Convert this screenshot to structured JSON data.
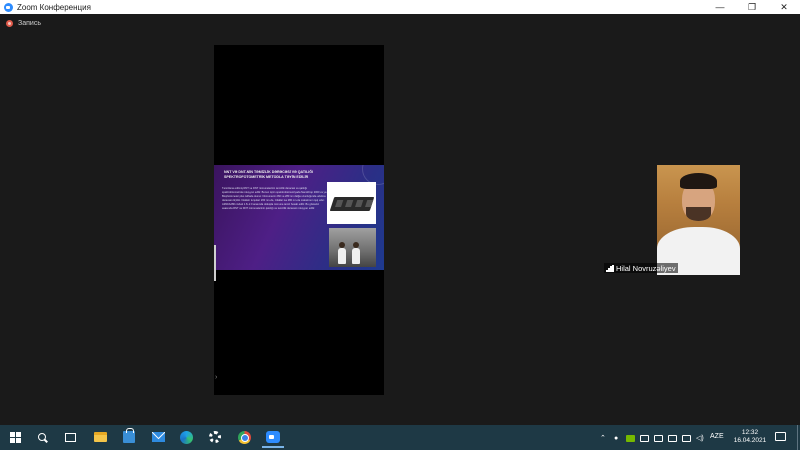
{
  "window": {
    "title": "Zoom Конференция",
    "controls": {
      "minimize": "—",
      "maximize": "❐",
      "close": "✕"
    }
  },
  "recording": {
    "label": "Запись",
    "icon": "record-dot-icon"
  },
  "slide": {
    "title": "NNT VƏ DNT-NİN TƏMİZLİK DƏRƏCƏSİ VƏ QATILIĞI SPEKTROFOTOMETRİK METODLA TƏYİN EDİLİR",
    "body": "Təmizlənə edilmiş RNT və DNT nümunələrinin təmizlik dərəcəsi və qatılığı spektrofotometrdə müəyyən edilir. Bunun üçün spektrofotometriyada NanoDrop 2000 və ya Biophotometer plus istifadə olunur. Nümunənin 260 və 280 nm dalğa uzunluğunda udulma dərəcəsi ölçülür. Nuklein turşuları 260 nm-də, zülallar isə 280 nm-də maksimum işıq udur. A260/A280 nisbəti 1.8–2.0 arasında olduqda nümunə təmiz hesab edilir. Bu göstərici əsasında RNT və DNT nümunələrinin qatılığı və təmizlik dərəcəsi müəyyən edilir."
  },
  "participant": {
    "name": "Hilal Novruzəliyev"
  },
  "taskbar": {
    "apps": [
      "start",
      "search",
      "task-view",
      "file-explorer",
      "store",
      "mail",
      "edge",
      "settings",
      "chrome",
      "zoom"
    ],
    "language": "AZE",
    "time": "12:32",
    "date": "16.04.2021"
  },
  "colors": {
    "accent": "#2d8cff",
    "taskbar": "#1e3945",
    "background": "#1a1a1a"
  }
}
